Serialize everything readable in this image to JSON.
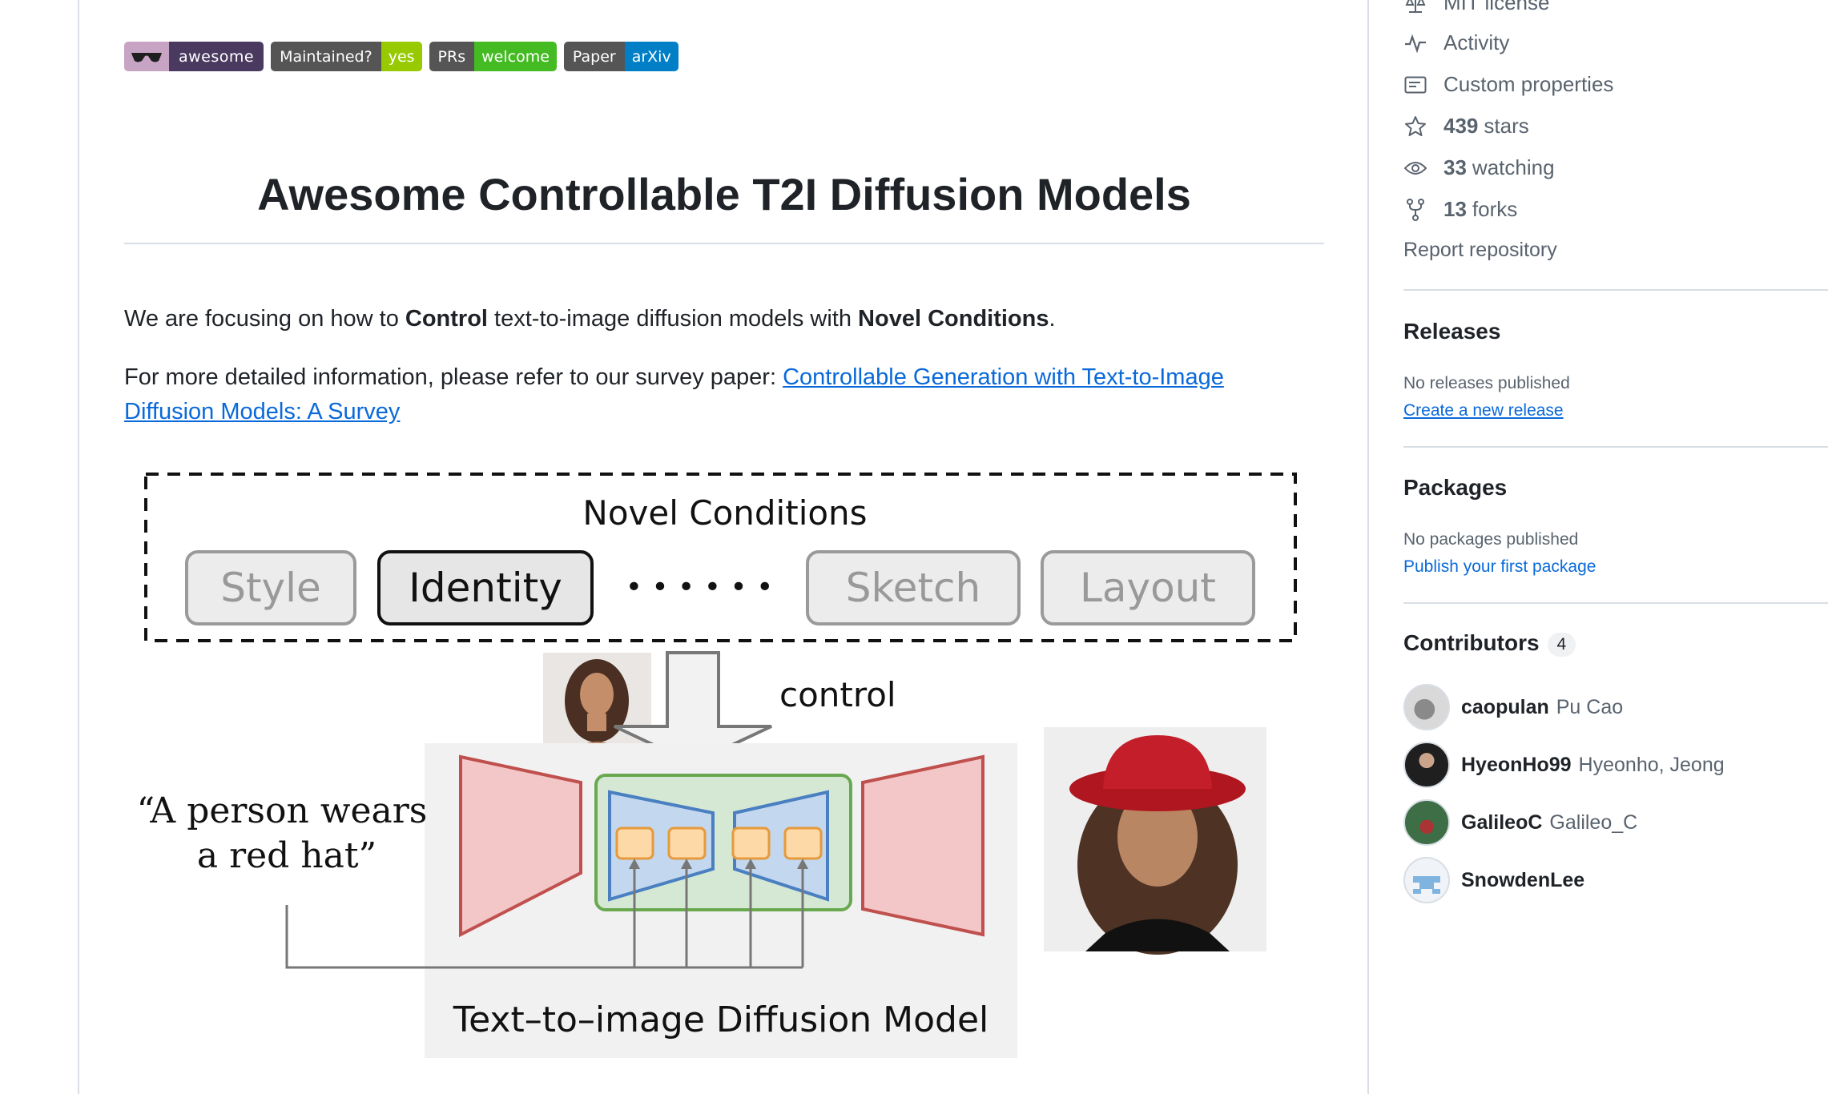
{
  "badges": [
    {
      "left": "",
      "right": "awesome",
      "right_color": "#4b3a60",
      "icon": "sunglasses-icon"
    },
    {
      "left": "Maintained?",
      "right": "yes",
      "right_color": "#97ca00"
    },
    {
      "left": "PRs",
      "right": "welcome",
      "right_color": "#4c1"
    },
    {
      "left": "Paper",
      "right": "arXiv",
      "right_color": "#007ec6"
    }
  ],
  "readme": {
    "title": "Awesome Controllable T2I Diffusion Models",
    "p1": {
      "t1": "We are focusing on how to ",
      "b1": "Control",
      "t2": " text-to-image diffusion models with ",
      "b2": "Novel Conditions",
      "t3": "."
    },
    "p2": {
      "t1": "For more detailed information, please refer to our survey paper: ",
      "link_line1": "Controllable Generation with Text-to-Image",
      "link_line2": "Diffusion Models: A Survey"
    }
  },
  "diagram": {
    "heading": "Novel Conditions",
    "conditions": [
      "Style",
      "Identity",
      "Sketch",
      "Layout"
    ],
    "ellipsis": "• • • • • •",
    "control_label": "control",
    "prompt_line1": "“A person wears",
    "prompt_line2": "a red hat”",
    "model_label": "Text–to–image Diffusion Model"
  },
  "sidebar": {
    "top_rows": [
      {
        "icon": "scale-icon",
        "num": "",
        "label": "MIT license"
      },
      {
        "icon": "pulse-icon",
        "num": "",
        "label": "Activity"
      },
      {
        "icon": "note-icon",
        "num": "",
        "label": "Custom properties"
      },
      {
        "icon": "star-icon",
        "num": "439",
        "label": "stars"
      },
      {
        "icon": "eye-icon",
        "num": "33",
        "label": "watching"
      },
      {
        "icon": "fork-icon",
        "num": "13",
        "label": "forks"
      }
    ],
    "report": "Report repository",
    "releases": {
      "heading": "Releases",
      "empty": "No releases published",
      "link": "Create a new release"
    },
    "packages": {
      "heading": "Packages",
      "empty": "No packages published",
      "link": "Publish your first package"
    },
    "contributors": {
      "heading": "Contributors",
      "count": "4",
      "items": [
        {
          "login": "caopulan",
          "name": "Pu Cao"
        },
        {
          "login": "HyeonHo99",
          "name": "Hyeonho, Jeong"
        },
        {
          "login": "GalileoC",
          "name": "Galileo_C"
        },
        {
          "login": "SnowdenLee",
          "name": ""
        }
      ]
    }
  }
}
